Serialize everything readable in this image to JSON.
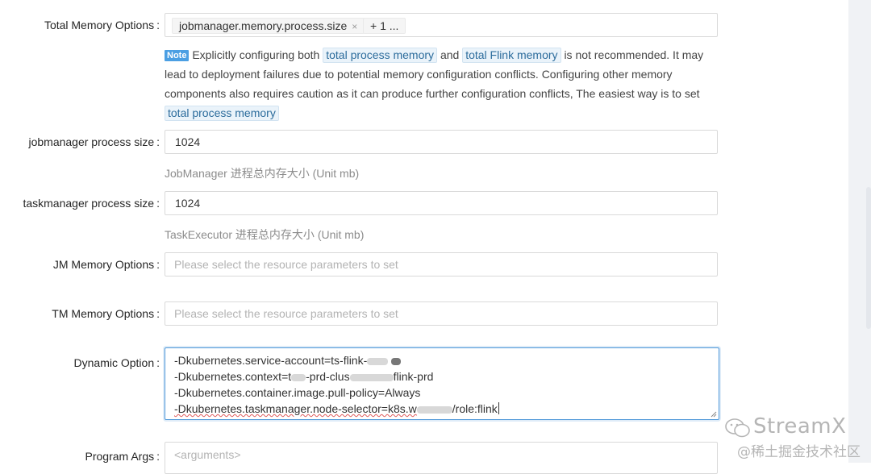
{
  "form": {
    "total_memory": {
      "label": "Total Memory Options",
      "tags": [
        {
          "text": "jobmanager.memory.process.size",
          "close": "×"
        },
        {
          "text": "+ 1 ..."
        }
      ],
      "note": {
        "badge": "Note",
        "seg1": "Explicitly configuring both",
        "code1": "total process memory",
        "seg2": "and",
        "code2": "total Flink memory",
        "seg3": "is not recommended. It may lead to deployment failures due to potential memory configuration conflicts. Configuring other memory components also requires caution as it can produce further configuration conflicts, The easiest way is to set",
        "code3": "total process memory"
      }
    },
    "jm_process_size": {
      "label": "jobmanager process size",
      "value": "1024",
      "help": "JobManager 进程总内存大小 (Unit mb)"
    },
    "tm_process_size": {
      "label": "taskmanager process size",
      "value": "1024",
      "help": "TaskExecutor 进程总内存大小 (Unit mb)"
    },
    "jm_memory_options": {
      "label": "JM Memory Options",
      "placeholder": "Please select the resource parameters to set"
    },
    "tm_memory_options": {
      "label": "TM Memory Options",
      "placeholder": "Please select the resource parameters to set"
    },
    "dynamic_option": {
      "label": "Dynamic Option",
      "lines": {
        "l1": "-Dkubernetes.service-account=ts-flink-",
        "l2a": "-Dkubernetes.context=t",
        "l2b": "-prd-clus",
        "l2c": "flink-prd",
        "l3": "-Dkubernetes.container.image.pull-policy=Always",
        "l4a": "-Dkubernetes.taskmanager.node-selector=k8s.w",
        "l4b": "/role:flink"
      }
    },
    "program_args": {
      "label": "Program Args",
      "placeholder": "<arguments>"
    },
    "colon": ":"
  },
  "watermark": {
    "brand": "StreamX",
    "sub": "@稀土掘金技术社区"
  },
  "colors": {
    "accent": "#4f98d9",
    "note_badge": "#4b9fe3",
    "code_tag_bg": "#eaf3fa"
  }
}
